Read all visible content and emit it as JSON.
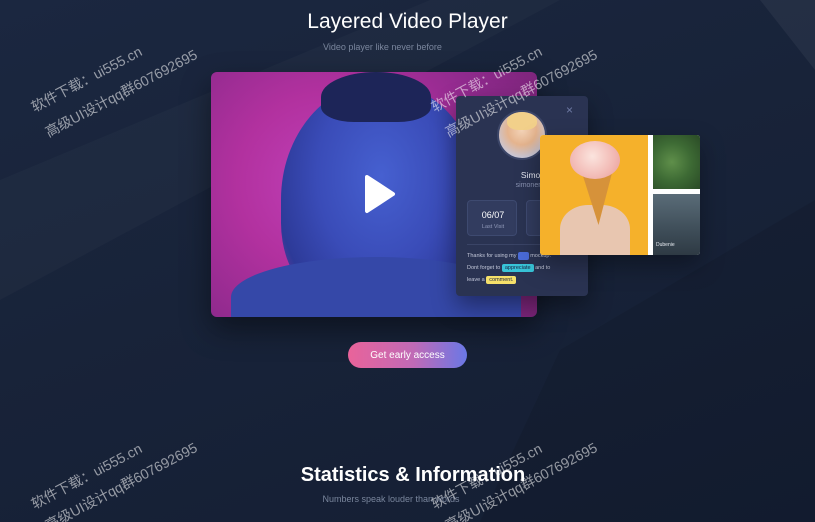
{
  "header": {
    "title": "Layered Video Player",
    "subtitle": "Video player like never before"
  },
  "profile": {
    "close_icon": "×",
    "name": "Simone Mi",
    "email": "simonem@gmai",
    "stats": [
      {
        "value": "06/07",
        "label": "Last Visit"
      },
      {
        "value": "",
        "label": ""
      }
    ],
    "message": {
      "line1_text": "Thanks for using my",
      "line1_tag": "",
      "line1_tail": "mockup.",
      "line2_text": "Dont forget to",
      "line2_tag": "appreciate",
      "line2_tail": "and to",
      "line3_text": "leave a",
      "line3_tag": "comment."
    }
  },
  "photos": {
    "caption": "Dubenie"
  },
  "cta": {
    "label": "Get early access"
  },
  "stats_section": {
    "title": "Statistics & Information",
    "subtitle": "Numbers speak louder than words"
  },
  "watermarks": {
    "line1": "软件下载：ui555.cn",
    "line2": "高级UI设计qq群607692695"
  },
  "colors": {
    "background": "#16213a",
    "cta_gradient_start": "#e9639a",
    "cta_gradient_end": "#6a78e6",
    "card": "#2a3352"
  },
  "icons": {
    "play": "play-icon",
    "close": "close-icon"
  }
}
